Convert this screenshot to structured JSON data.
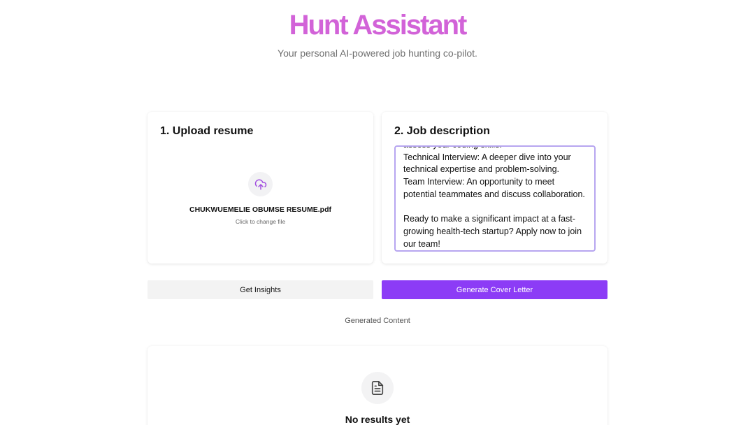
{
  "header": {
    "title": "Hunt Assistant",
    "subtitle": "Your personal AI-powered job hunting co-pilot."
  },
  "upload": {
    "title": "1. Upload resume",
    "icon": "cloud-upload-icon",
    "filename": "CHUKWUEMELIE OBUMSE RESUME.pdf",
    "hint": "Click to change file"
  },
  "job": {
    "title": "2. Job description",
    "text": "assess your coding skills.\nTechnical Interview: A deeper dive into your technical expertise and problem-solving.\nTeam Interview: An opportunity to meet potential teammates and discuss collaboration.\n\nReady to make a significant impact at a fast-growing health-tech startup? Apply now to join our team!"
  },
  "actions": {
    "insights_label": "Get Insights",
    "cover_label": "Generate Cover Letter"
  },
  "results": {
    "section_label": "Generated Content",
    "icon": "document-icon",
    "empty_text": "No results yet"
  },
  "colors": {
    "brand_title": "#d263d8",
    "primary_button": "#8c3cf6",
    "textarea_border": "#b7a6f0",
    "icon_purple": "#a24fe0"
  }
}
